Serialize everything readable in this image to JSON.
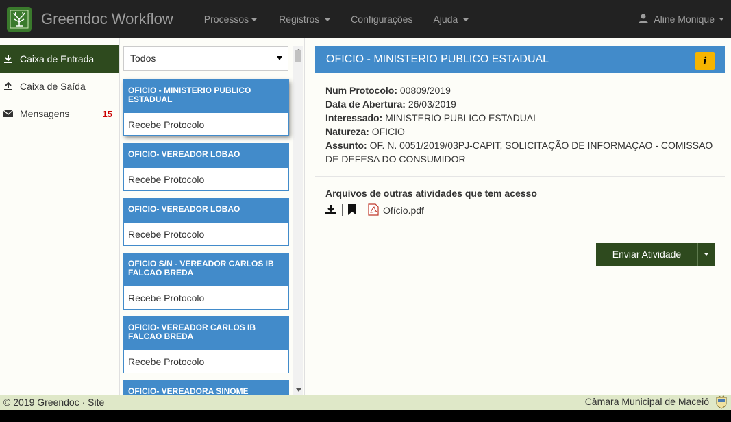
{
  "app": {
    "brand": "Greendoc Workflow"
  },
  "nav": {
    "items": [
      {
        "label": "Processos",
        "dropdown": true
      },
      {
        "label": "Registros",
        "dropdown": true
      },
      {
        "label": "Configurações",
        "dropdown": false
      },
      {
        "label": "Ajuda",
        "dropdown": true
      }
    ],
    "user": "Aline Monique"
  },
  "sidebar": {
    "items": [
      {
        "label": "Caixa de Entrada",
        "icon": "download-icon",
        "active": true
      },
      {
        "label": "Caixa de Saída",
        "icon": "upload-icon",
        "active": false
      },
      {
        "label": "Mensagens",
        "icon": "envelope-icon",
        "active": false,
        "badge": "15"
      }
    ]
  },
  "list": {
    "filter": "Todos",
    "cards": [
      {
        "title": "OFICIO - MINISTERIO PUBLICO ESTADUAL",
        "body": "Recebe Protocolo"
      },
      {
        "title": "OFICIO- VEREADOR LOBAO",
        "body": "Recebe Protocolo"
      },
      {
        "title": "OFICIO- VEREADOR LOBAO",
        "body": "Recebe Protocolo"
      },
      {
        "title": "OFICIO S/N - VEREADOR CARLOS IB FALCAO BREDA",
        "body": "Recebe Protocolo"
      },
      {
        "title": "OFICIO- VEREADOR CARLOS IB FALCAO BREDA",
        "body": "Recebe Protocolo"
      },
      {
        "title": "OFICIO- VEREADORA SINOME",
        "body": ""
      }
    ]
  },
  "detail": {
    "title": "OFICIO - MINISTERIO PUBLICO ESTADUAL",
    "info_label": "i",
    "fields": {
      "num_protocolo_label": "Num Protocolo:",
      "num_protocolo": "00809/2019",
      "data_abertura_label": "Data de Abertura:",
      "data_abertura": "26/03/2019",
      "interessado_label": "Interessado:",
      "interessado": "MINISTERIO PUBLICO ESTADUAL",
      "natureza_label": "Natureza:",
      "natureza": "OFICIO",
      "assunto_label": "Assunto:",
      "assunto": "OF. N. 0051/2019/03PJ-CAPIT, SOLICITAÇÃO DE INFORMAÇAO - COMISSAO DE DEFESA DO CONSUMIDOR"
    },
    "files_title": "Arquivos de outras atividades que tem acesso",
    "file_name": "Ofício.pdf",
    "send_label": "Enviar Atividade"
  },
  "footer": {
    "left": "© 2019 Greendoc · Site",
    "right": "Câmara Municipal de Maceió"
  }
}
